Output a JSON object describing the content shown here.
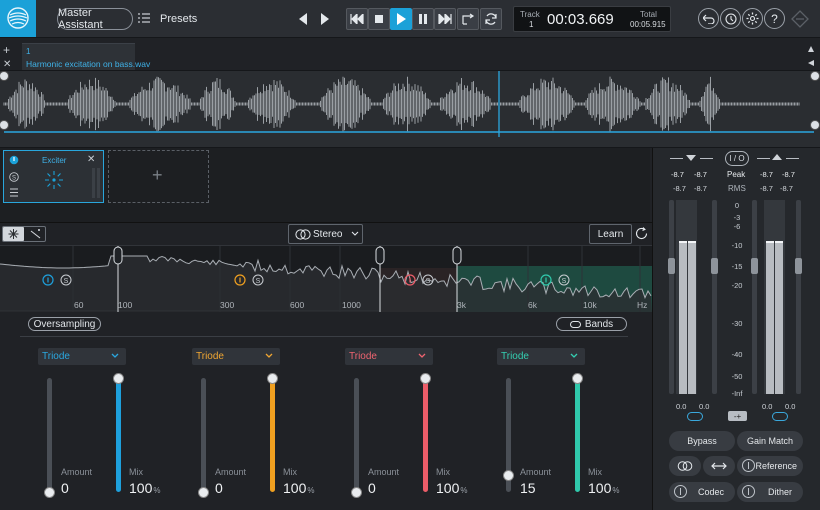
{
  "topbar": {
    "assistant_label": "Master Assistant",
    "presets_label": "Presets",
    "track_label": "Track",
    "track_number": "1",
    "time": "00:03.669",
    "total_label": "Total",
    "total_time": "00:05.915"
  },
  "file": {
    "index": "1",
    "name": "Harmonic excitation on bass.wav"
  },
  "module": {
    "name": "Exciter"
  },
  "editor": {
    "stereo_label": "Stereo",
    "learn_label": "Learn",
    "oversampling_label": "Oversampling",
    "bands_label": "Bands",
    "freq_labels": [
      "60",
      "100",
      "300",
      "600",
      "1000",
      "3k",
      "6k",
      "10k",
      "Hz"
    ]
  },
  "bands": [
    {
      "mode": "Triode",
      "amount_label": "Amount",
      "amount": "0",
      "mix_label": "Mix",
      "mix": "100",
      "mix_unit": "%",
      "color": "#1ea0dc",
      "mode_color": "#2aa7df"
    },
    {
      "mode": "Triode",
      "amount_label": "Amount",
      "amount": "0",
      "mix_label": "Mix",
      "mix": "100",
      "mix_unit": "%",
      "color": "#f0a020",
      "mode_color": "#f0a632"
    },
    {
      "mode": "Triode",
      "amount_label": "Amount",
      "amount": "0",
      "mix_label": "Mix",
      "mix": "100",
      "mix_unit": "%",
      "color": "#ec5d69",
      "mode_color": "#ef6470"
    },
    {
      "mode": "Triode",
      "amount_label": "Amount",
      "amount": "15",
      "mix_label": "Mix",
      "mix": "100",
      "mix_unit": "%",
      "color": "#30c9ac",
      "mode_color": "#34cfb2"
    }
  ],
  "meters": {
    "io_label": "I / O",
    "peak_label": "Peak",
    "rms_label": "RMS",
    "in_peak_l": "-8.7",
    "in_peak_r": "-8.7",
    "out_peak_l": "-8.7",
    "out_peak_r": "-8.7",
    "in_rms_l": "-8.7",
    "in_rms_r": "-8.7",
    "out_rms_l": "-8.7",
    "out_rms_r": "-8.7",
    "scale": [
      "0",
      "-3",
      "-6",
      "-10",
      "-15",
      "-20",
      "-30",
      "-40",
      "-50",
      "-Inf"
    ],
    "in_gain_l": "0.0",
    "in_gain_r": "0.0",
    "out_gain_l": "0.0",
    "out_gain_r": "0.0",
    "in_level": 0.79,
    "out_level": 0.79
  },
  "buttons": {
    "bypass": "Bypass",
    "gain_match": "Gain Match",
    "reference": "Reference",
    "codec": "Codec",
    "dither": "Dither"
  }
}
